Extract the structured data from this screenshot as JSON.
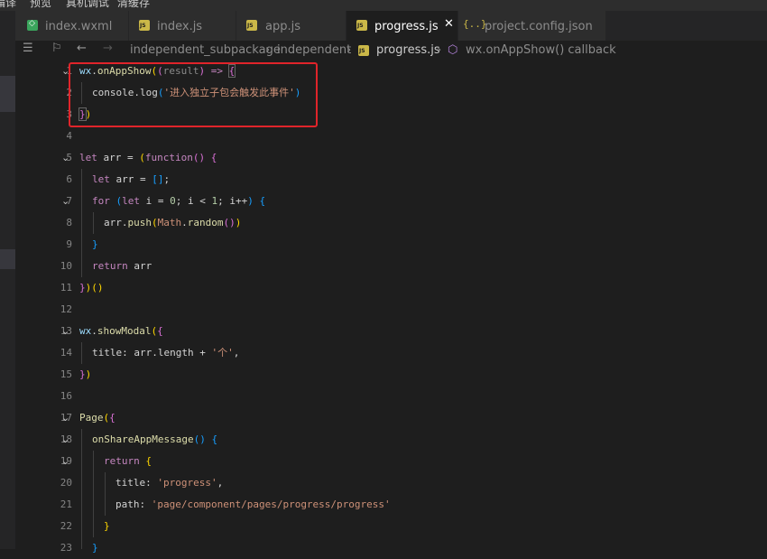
{
  "menu": [
    "编译",
    "预览",
    "真机调试",
    "清缓存"
  ],
  "tabs": [
    {
      "label": "index.wxml",
      "icon": "wxml-file-icon"
    },
    {
      "label": "index.js",
      "icon": "js-file-icon"
    },
    {
      "label": "app.js",
      "icon": "js-file-icon"
    },
    {
      "label": "progress.js",
      "icon": "js-file-icon",
      "active": true
    },
    {
      "label": "project.config.json",
      "icon": "json-file-icon"
    }
  ],
  "breadcrumb": [
    "independent_subpackage",
    "independent",
    "progress.js",
    "wx.onAppShow() callback"
  ],
  "editor": {
    "line_numbers": [
      "1",
      "2",
      "3",
      "4",
      "5",
      "6",
      "7",
      "8",
      "9",
      "10",
      "11",
      "12",
      "13",
      "14",
      "15",
      "16",
      "17",
      "18",
      "19",
      "20",
      "21",
      "22",
      "23"
    ],
    "tokens": {
      "wx": "wx",
      "onAppShow": "onAppShow",
      "result": "result",
      "arrow": "=>",
      "console_log": "console.log",
      "log_msg": "'进入独立子包会触发此事件'",
      "let": "let",
      "arr": "arr",
      "function": "function",
      "empty_arr": "[]",
      "for": "for",
      "i": "i",
      "zero": "0",
      "one": "1",
      "inc": "i++",
      "push": "push",
      "math": "Math",
      "random": "random",
      "return": "return",
      "showModal": "showModal",
      "title": "title",
      "length": "length",
      "ge": "'个'",
      "page": "Page",
      "onShare": "onShareAppMessage",
      "progress": "'progress'",
      "path": "path",
      "path_val": "'page/component/pages/progress/progress'"
    }
  },
  "colors": {
    "highlight": "#e0242a",
    "keyword": "#c586c0",
    "function": "#dcdcaa",
    "string": "#ce9178",
    "number": "#b5cea8"
  }
}
